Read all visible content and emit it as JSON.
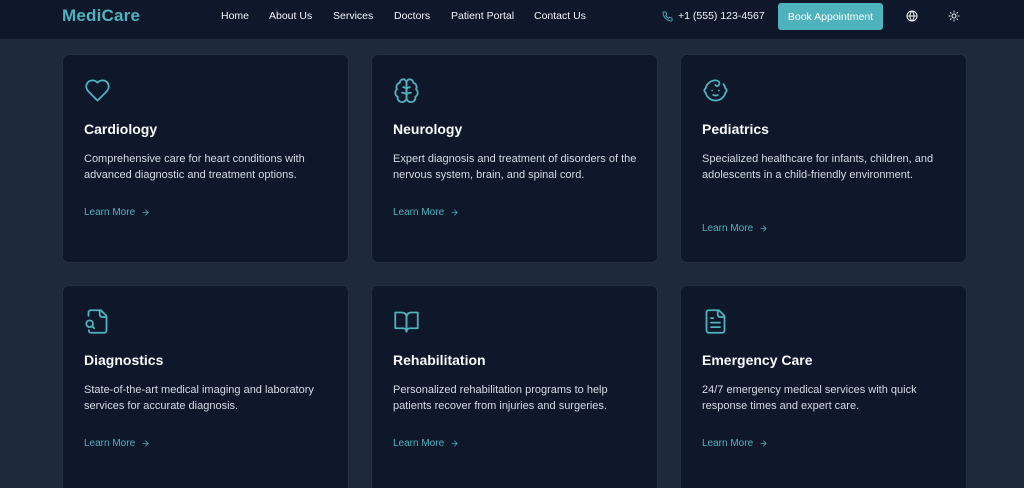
{
  "brand": {
    "name": "MediCare",
    "accent_color": "#4fb3bd"
  },
  "nav": {
    "links": [
      "Home",
      "About Us",
      "Services",
      "Doctors",
      "Patient Portal",
      "Contact Us"
    ],
    "phone_icon": "phone-icon",
    "phone": "+1 (555) 123-4567",
    "book_label": "Book Appointment",
    "language_icon": "globe-icon",
    "theme_icon": "sun-icon"
  },
  "services": [
    {
      "icon": "heart-icon",
      "title": "Cardiology",
      "description": "Comprehensive care for heart conditions with advanced diagnostic and treatment options.",
      "link": "Learn More"
    },
    {
      "icon": "brain-icon",
      "title": "Neurology",
      "description": "Expert diagnosis and treatment of disorders of the nervous system, brain, and spinal cord.",
      "link": "Learn More"
    },
    {
      "icon": "baby-icon",
      "title": "Pediatrics",
      "description": "Specialized healthcare for infants, children, and adolescents in a child-friendly environment.",
      "link": "Learn More"
    },
    {
      "icon": "file-search-icon",
      "title": "Diagnostics",
      "description": "State-of-the-art medical imaging and laboratory services for accurate diagnosis.",
      "link": "Learn More"
    },
    {
      "icon": "book-open-icon",
      "title": "Rehabilitation",
      "description": "Personalized rehabilitation programs to help patients recover from injuries and surgeries.",
      "link": "Learn More"
    },
    {
      "icon": "file-text-icon",
      "title": "Emergency Care",
      "description": "24/7 emergency medical services with quick response times and expert care.",
      "link": "Learn More"
    }
  ]
}
